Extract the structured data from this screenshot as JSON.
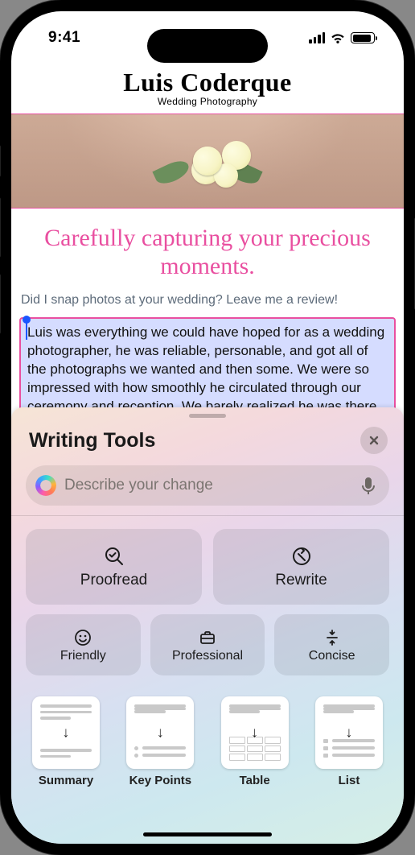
{
  "status": {
    "time": "9:41"
  },
  "header": {
    "name": "Luis Coderque",
    "subtitle": "Wedding Photography"
  },
  "page": {
    "tagline": "Carefully capturing your precious moments.",
    "prompt": "Did I snap photos at your wedding? Leave me a review!",
    "selected_text": "Luis was everything we could have hoped for as a wedding photographer, he was reliable, personable, and got all of the photographs we wanted and then some. We were so impressed with how smoothly he circulated through our ceremony and reception. We barely realized he was there except when he was very"
  },
  "panel": {
    "title": "Writing Tools",
    "placeholder": "Describe your change",
    "proofread": "Proofread",
    "rewrite": "Rewrite",
    "friendly": "Friendly",
    "professional": "Professional",
    "concise": "Concise",
    "summary": "Summary",
    "keypoints": "Key Points",
    "table": "Table",
    "list": "List"
  }
}
